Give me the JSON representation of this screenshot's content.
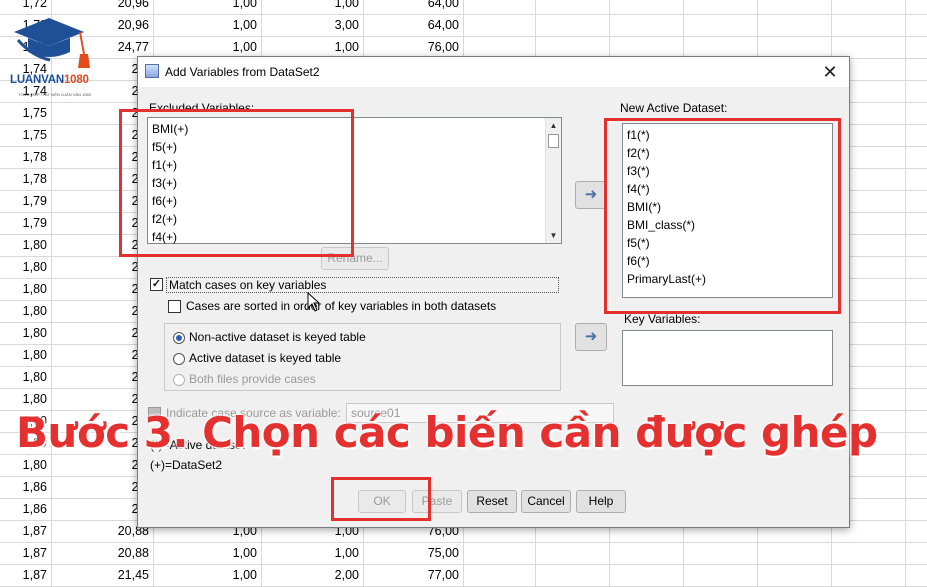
{
  "sheet": {
    "rows": [
      [
        "1,72",
        "20,96",
        "1,00",
        "1,00",
        "64,00"
      ],
      [
        "1,73",
        "20,96",
        "1,00",
        "3,00",
        "64,00"
      ],
      [
        "1,74",
        "24,77",
        "1,00",
        "1,00",
        "76,00"
      ],
      [
        "1,74",
        "24,",
        "",
        "",
        ""
      ],
      [
        "1,74",
        "24,",
        "",
        "",
        ""
      ],
      [
        "1,75",
        "22,",
        "",
        "",
        ""
      ],
      [
        "1,75",
        "22,",
        "",
        "",
        ""
      ],
      [
        "1,78",
        "25,",
        "",
        "",
        ""
      ],
      [
        "1,78",
        "25,",
        "",
        "",
        ""
      ],
      [
        "1,79",
        "22,",
        "",
        "",
        ""
      ],
      [
        "1,79",
        "22,",
        "",
        "",
        ""
      ],
      [
        "1,80",
        "21,",
        "",
        "",
        ""
      ],
      [
        "1,80",
        "21,",
        "",
        "",
        ""
      ],
      [
        "1,80",
        "21,",
        "",
        "",
        ""
      ],
      [
        "1,80",
        "23,",
        "",
        "",
        ""
      ],
      [
        "1,80",
        "23,",
        "",
        "",
        ""
      ],
      [
        "1,80",
        "23,",
        "",
        "",
        ""
      ],
      [
        "1,80",
        "23,",
        "",
        "",
        ""
      ],
      [
        "1,80",
        "24,",
        "",
        "",
        ""
      ],
      [
        "1,80",
        "24,",
        "",
        "",
        ""
      ],
      [
        "1,80",
        "24,",
        "",
        "",
        ""
      ],
      [
        "1,80",
        "27,",
        "",
        "",
        ""
      ],
      [
        "1,86",
        "21,",
        "",
        "",
        ""
      ],
      [
        "1,86",
        "21,",
        "",
        "",
        ""
      ],
      [
        "1,87",
        "20,88",
        "1,00",
        "1,00",
        "76,00"
      ],
      [
        "1,87",
        "20,88",
        "1,00",
        "1,00",
        "75,00"
      ],
      [
        "1,87",
        "21,45",
        "1,00",
        "2,00",
        "77,00"
      ]
    ]
  },
  "logo": {
    "brand_a": "LUANVAN",
    "brand_b": "1080",
    "tagline": "TỔNG HỢP THƯ VIỆN LUẬN VĂN 1080"
  },
  "dialog": {
    "title": "Add Variables from DataSet2",
    "close_glyph": "✕",
    "excluded_label": "Excluded Variables:",
    "excluded_items": [
      "BMI(+)",
      "f5(+)",
      "f1(+)",
      "f3(+)",
      "f6(+)",
      "f2(+)",
      "f4(+)"
    ],
    "new_active_label": "New Active Dataset:",
    "new_active_items": [
      "f1(*)",
      "f2(*)",
      "f3(*)",
      "f4(*)",
      "BMI(*)",
      "BMI_class(*)",
      "f5(*)",
      "f6(*)",
      "PrimaryLast(+)"
    ],
    "key_variables_label": "Key Variables:",
    "rename_label": "Rename...",
    "match_cases_label": "Match cases on key variables",
    "cases_sorted_label": "Cases are sorted in order of key variables in both datasets",
    "radio_non_active": "Non-active dataset is keyed table",
    "radio_active": "Active dataset is keyed table",
    "radio_both": "Both files provide cases",
    "indicate_source_label": "Indicate case source as variable:",
    "source_value": "source01",
    "legend_active": "(*)=Active dataset",
    "legend_dataset2": "(+)=DataSet2",
    "arrow_glyph": "➜",
    "buttons": {
      "ok": "OK",
      "paste": "Paste",
      "reset": "Reset",
      "cancel": "Cancel",
      "help": "Help"
    }
  },
  "caption": "Bước 3. Chọn các biến cần được ghép",
  "colors": {
    "highlight": "#e53030",
    "accent": "#2a5fbf"
  }
}
